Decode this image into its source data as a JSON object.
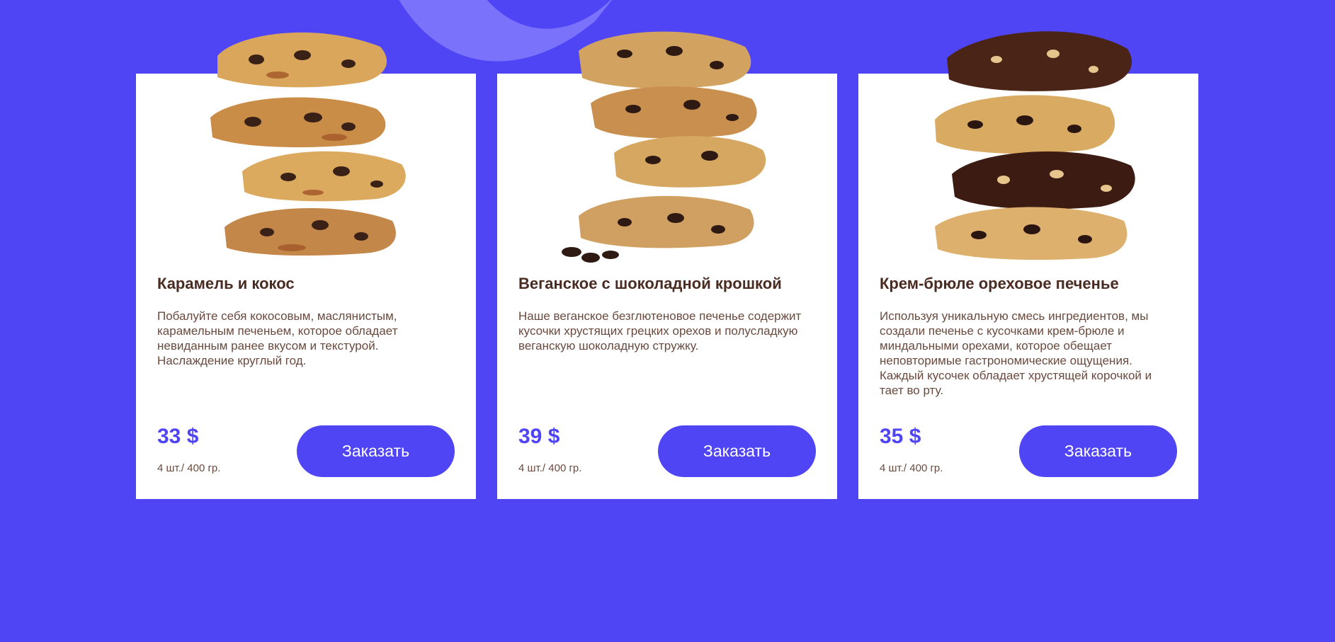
{
  "products": [
    {
      "title": "Карамель и кокос",
      "description": "Побалуйте себя кокосовым, маслянистым, карамельным печеньем, которое обладает невиданным ранее вкусом и текстурой. Наслаждение круглый год.",
      "price": "33 $",
      "weight": "4 шт./ 400 гр.",
      "button_label": "Заказать",
      "image": "caramel-coconut-cookies-stack"
    },
    {
      "title": "Веганское с шоколадной крошкой",
      "description": "Наше веганское безглютеновое печенье содержит кусочки хрустящих грецких орехов и полусладкую веганскую шоколадную стружку.",
      "price": "39 $",
      "weight": "4 шт./ 400 гр.",
      "button_label": "Заказать",
      "image": "vegan-chocolate-chip-cookies-stack"
    },
    {
      "title": "Крем-брюле ореховое печенье",
      "description": "Используя уникальную смесь ингредиентов, мы создали печенье с кусочками крем-брюле и миндальными орехами, которое обещает неповторимые гастрономические ощущения. Каждый кусочек обладает хрустящей корочкой и тает во рту.",
      "price": "35 $",
      "weight": "4 шт./ 400 гр.",
      "button_label": "Заказать",
      "image": "creme-brulee-nut-cookies-stack"
    }
  ],
  "colors": {
    "background": "#5045F5",
    "card": "#FFFFFF",
    "title": "#4A2B22",
    "text": "#6A4A3E",
    "accent": "#5045F5",
    "swoosh": "#7A72FA"
  }
}
